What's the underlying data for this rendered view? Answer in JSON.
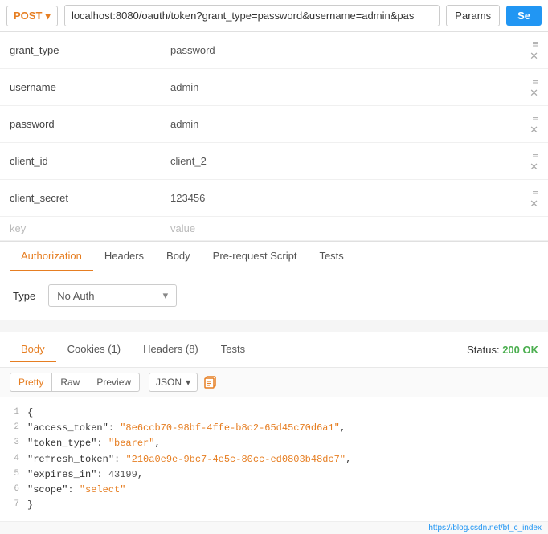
{
  "topbar": {
    "method": "POST",
    "url": "localhost:8080/oauth/token?grant_type=password&username=admin&pas",
    "params_label": "Params",
    "send_label": "Se"
  },
  "params": {
    "rows": [
      {
        "key": "grant_type",
        "value": "password"
      },
      {
        "key": "username",
        "value": "admin"
      },
      {
        "key": "password",
        "value": "admin"
      },
      {
        "key": "client_id",
        "value": "client_2"
      },
      {
        "key": "client_secret",
        "value": "123456"
      }
    ],
    "empty_key": "key",
    "empty_value": "value"
  },
  "tabs": {
    "items": [
      {
        "label": "Authorization",
        "active": true
      },
      {
        "label": "Headers",
        "active": false
      },
      {
        "label": "Body",
        "active": false
      },
      {
        "label": "Pre-request Script",
        "active": false
      },
      {
        "label": "Tests",
        "active": false
      }
    ]
  },
  "auth": {
    "type_label": "Type",
    "selected": "No Auth"
  },
  "response": {
    "tabs": [
      {
        "label": "Body",
        "active": true
      },
      {
        "label": "Cookies (1)",
        "active": false
      },
      {
        "label": "Headers (8)",
        "active": false
      },
      {
        "label": "Tests",
        "active": false
      }
    ],
    "status_label": "Status:",
    "status_code": "200 OK",
    "format_btns": [
      {
        "label": "Pretty",
        "active": true
      },
      {
        "label": "Raw",
        "active": false
      },
      {
        "label": "Preview",
        "active": false
      }
    ],
    "format_select": "JSON",
    "lines": [
      {
        "num": "1",
        "content": "{"
      },
      {
        "num": "2",
        "content": "    \"access_token\": \"8e6ccb70-98bf-4ffe-b8c2-65d45c70d6a1\","
      },
      {
        "num": "3",
        "content": "    \"token_type\": \"bearer\","
      },
      {
        "num": "4",
        "content": "    \"refresh_token\": \"210a0e9e-9bc7-4e5c-80cc-ed0803b48dc7\","
      },
      {
        "num": "5",
        "content": "    \"expires_in\": 43199,"
      },
      {
        "num": "6",
        "content": "    \"scope\": \"select\""
      },
      {
        "num": "7",
        "content": "}"
      }
    ],
    "watermark": "https://blog.csdn.net/bt_c_index"
  }
}
